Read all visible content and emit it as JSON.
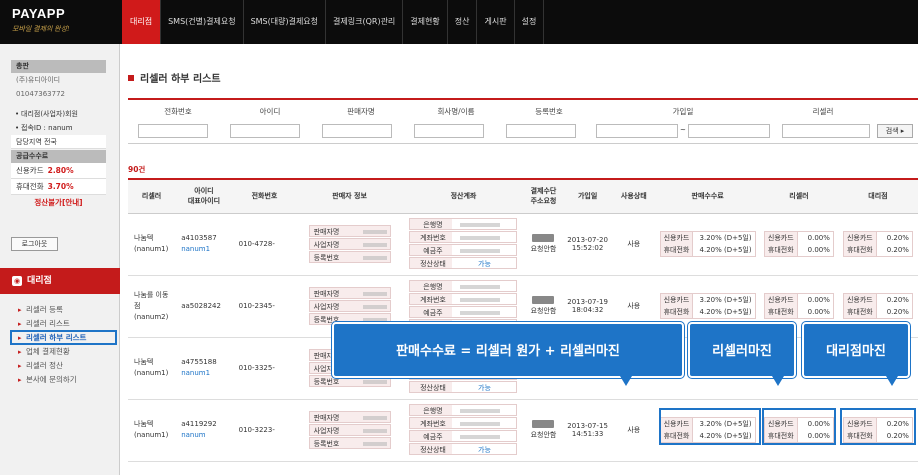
{
  "logo": {
    "title": "PAYAPP",
    "slogan": "모바일 결제의 완성!"
  },
  "nav": [
    "대리점",
    "SMS(건별)결제요청",
    "SMS(대량)결제요청",
    "결제링크(QR)관리",
    "결제현황",
    "정산",
    "게시판",
    "설정"
  ],
  "side": {
    "header": "총판",
    "company": "(주)유디아이디",
    "phone": "01047363772",
    "role": "대리점(사업자)회원",
    "login": "접속ID : nanum",
    "area": "담당지역 전국",
    "fee_header": "공급수수료",
    "card_label": "신용카드",
    "card_pct": "2.80%",
    "phone_label": "휴대전화",
    "phone_pct": "3.70%",
    "settle": "정산불가[안내]",
    "logout": "로그아웃",
    "menu_title": "대리점",
    "menu": [
      "리셀러 등록",
      "리셀러 리스트",
      "리셀러 하부 리스트",
      "업체 결제현황",
      "리셀러 정산",
      "본사에 문의하기"
    ]
  },
  "page": {
    "title": "리셀러 하부 리스트",
    "count": "90건"
  },
  "search": {
    "headers": [
      "전화번호",
      "아이디",
      "판매자명",
      "회사명/이름",
      "등록번호",
      "가입일",
      "리셀러"
    ],
    "tilde": "~",
    "button": "검색 ▸"
  },
  "table": {
    "headers": [
      "리셀러",
      "아이디\n대표아이디",
      "전화번호",
      "판매자 정보",
      "정산계좌",
      "결제수단\n주소요청",
      "가입일",
      "사용상태",
      "판매수수료",
      "리셀러",
      "대리점"
    ],
    "labels": {
      "seller": "판매자명",
      "biz": "사업자명",
      "reg": "등록번호",
      "bank": "은행명",
      "acct": "계좌번호",
      "holder": "예금주",
      "status": "정산상태",
      "status_val": "가능",
      "card": "신용카드",
      "phone": "휴대전화",
      "pay": "요청안함"
    },
    "rows": [
      {
        "reseller": "나눔텍\n(nanum1)",
        "id": "a4103587",
        "rep": "nanum1",
        "tel": "010-4728-",
        "date": "2013-07-20\n15:52:02",
        "use": "사용",
        "fee_card": "3.20% (D+5일)",
        "fee_phone": "4.20% (D+5일)",
        "r_card": "0.00%",
        "r_phone": "0.00%",
        "a_card": "0.20%",
        "a_phone": "0.20%"
      },
      {
        "reseller": "나눔를 이동\n점 (nanum2)",
        "id": "aa5028242",
        "rep": "",
        "tel": "010-2345-",
        "date": "2013-07-19\n18:04:32",
        "use": "사용",
        "fee_card": "3.20% (D+5일)",
        "fee_phone": "4.20% (D+5일)",
        "r_card": "0.00%",
        "r_phone": "0.00%",
        "a_card": "0.20%",
        "a_phone": "0.20%"
      },
      {
        "reseller": "나눔텍\n(nanum1)",
        "id": "a4755188",
        "rep": "nanum1",
        "tel": "010-3325-",
        "date": "",
        "use": "",
        "fee_card": "",
        "fee_phone": "",
        "r_card": "",
        "r_phone": "",
        "a_card": "",
        "a_phone": ""
      },
      {
        "reseller": "나눔텍\n(nanum1)",
        "id": "a4119292",
        "rep": "nanum",
        "tel": "010-3223-",
        "date": "2013-07-15\n14:51:33",
        "use": "사용",
        "fee_card": "3.20% (D+5일)",
        "fee_phone": "4.20% (D+5일)",
        "r_card": "0.00%",
        "r_phone": "0.00%",
        "a_card": "0.20%",
        "a_phone": "0.20%"
      }
    ]
  },
  "callouts": {
    "fee": "판매수수료 = 리셀러 원가 + 리셀러마진",
    "reseller": "리셀러마진",
    "agency": "대리점마진"
  }
}
